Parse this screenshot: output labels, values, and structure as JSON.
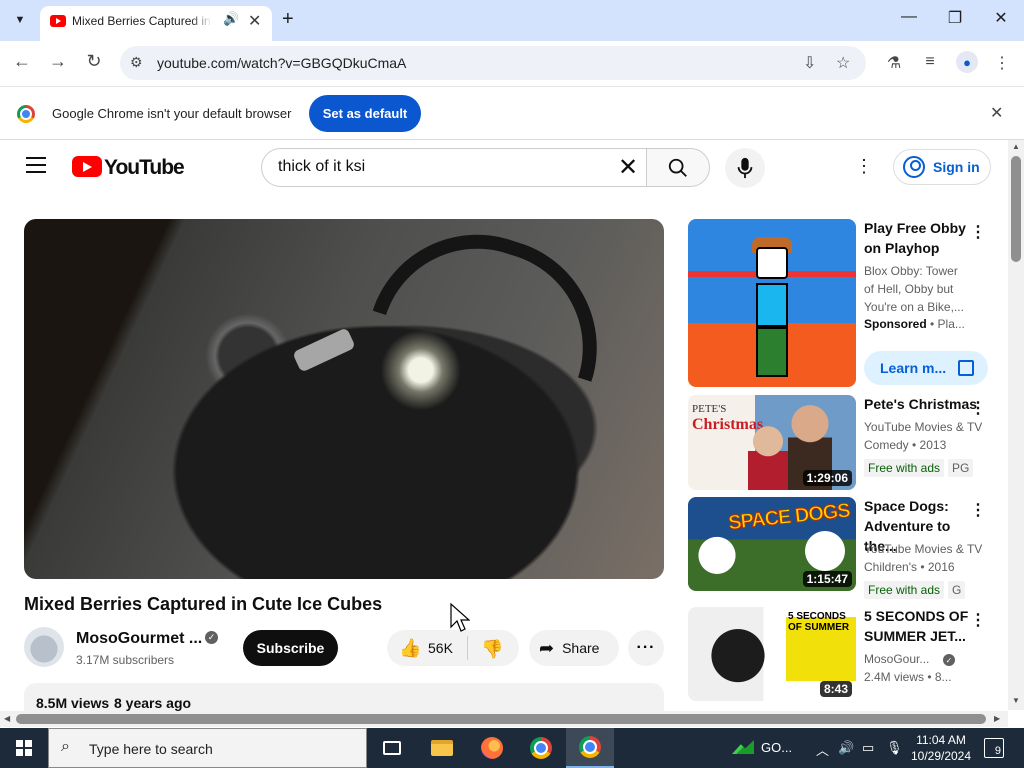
{
  "browser": {
    "tab": {
      "title": "Mixed Berries Captured in C",
      "audio_icon": "speaker-icon",
      "close": "✕"
    },
    "new_tab": "+",
    "window_controls": {
      "minimize": "—",
      "maximize": "❐",
      "close": "✕"
    },
    "url": "youtube.com/watch?v=GBGQDkuCmaA",
    "infobar": {
      "text": "Google Chrome isn't your default browser",
      "button": "Set as default"
    }
  },
  "youtube": {
    "wordmark": "YouTube",
    "search": {
      "value": "thick of it ksi"
    },
    "sign_in": "Sign in",
    "video": {
      "title": "Mixed Berries Captured in Cute Ice Cubes",
      "channel": "MosoGourmet ...",
      "subscribers": "3.17M subscribers",
      "subscribe": "Subscribe",
      "likes": "56K",
      "share": "Share",
      "views": "8.5M views",
      "age": "8 years ago"
    },
    "recommendations": [
      {
        "title_line1": "Play Free Obby",
        "title_line2": "on Playhop",
        "meta_line1": "Blox Obby: Tower",
        "meta_line2": "of Hell, Obby but",
        "meta_line3": "You're on a Bike,...",
        "sponsored": "Sponsored",
        "sponsored_suffix": " • Pla...",
        "cta": "Learn m..."
      },
      {
        "title": "Pete's Christmas",
        "meta_line1": "YouTube Movies & TV",
        "meta_line2": "Comedy • 2013",
        "badge": "Free with ads",
        "rating": "PG",
        "duration": "1:29:06",
        "thumb_text": "PETE'S",
        "thumb_text2": "Christmas"
      },
      {
        "title_line1": "Space Dogs:",
        "title_line2": "Adventure to the...",
        "meta_line1": "YouTube Movies & TV",
        "meta_line2": "Children's • 2016",
        "badge": "Free with ads",
        "rating": "G",
        "duration": "1:15:47",
        "thumb_text": "SPACE DOGS"
      },
      {
        "title_line1": "5 SECONDS OF",
        "title_line2": "SUMMER JET...",
        "meta_line1": "MosoGour...",
        "meta_line2": "2.4M views • 8...",
        "duration": "8:43",
        "thumb_text": "5 SECONDS OF SUMMER"
      }
    ]
  },
  "taskbar": {
    "search_placeholder": "Type here to search",
    "go_label": "GO...",
    "time": "11:04 AM",
    "date": "10/29/2024",
    "notifications": "9"
  }
}
